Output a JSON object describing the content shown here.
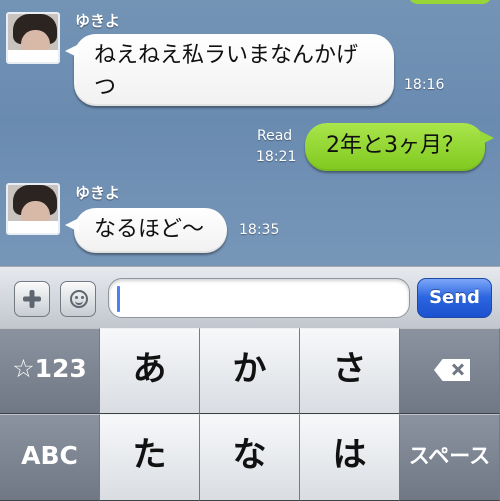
{
  "chat": {
    "sender": "ゆきよ",
    "messages": [
      {
        "direction": "incoming",
        "sender": "ゆきよ",
        "text": "ねえねえ私ラいまなんかげ\nつ",
        "time": "18:16"
      },
      {
        "direction": "outgoing",
        "status": "Read",
        "text": "2年と3ヶ月？",
        "time": "18:21"
      },
      {
        "direction": "incoming",
        "sender": "ゆきよ",
        "text": "なるほど〜",
        "time": "18:35"
      }
    ]
  },
  "input": {
    "value": "",
    "placeholder": "",
    "send_label": "Send"
  },
  "keyboard": {
    "rows": [
      [
        "☆123",
        "あ",
        "か",
        "さ",
        "backspace"
      ],
      [
        "ABC",
        "た",
        "な",
        "は",
        "スペース"
      ]
    ]
  },
  "icons": {
    "plus": "plus-icon",
    "emoji": "smile-icon",
    "backspace": "backspace-icon"
  },
  "colors": {
    "incoming_bubble": "#ffffff",
    "outgoing_bubble": "#8fd22c",
    "send_button": "#2b65df"
  }
}
